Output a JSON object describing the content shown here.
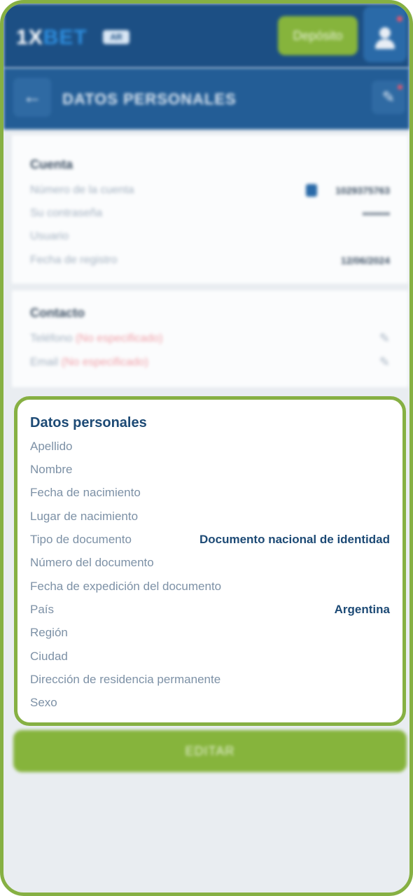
{
  "header": {
    "logo_text_1": "1X",
    "logo_text_2": "BET",
    "logo_badge": "AR",
    "deposit_label": "Depósito"
  },
  "pagebar": {
    "title": "DATOS PERSONALES"
  },
  "account": {
    "title": "Cuenta",
    "rows": [
      {
        "label": "Número de la cuenta",
        "value": "1029375763"
      },
      {
        "label": "Su contraseña",
        "value": "••••••••"
      },
      {
        "label": "Usuario",
        "value": ""
      },
      {
        "label": "Fecha de registro",
        "value": "12/06/2024"
      }
    ]
  },
  "contact": {
    "title": "Contacto",
    "phone_label": "Teléfono",
    "phone_value": "(No especificado)",
    "email_label": "Email",
    "email_value": "(No especificado)"
  },
  "personal": {
    "title": "Datos personales",
    "rows": [
      {
        "label": "Apellido",
        "value": ""
      },
      {
        "label": "Nombre",
        "value": ""
      },
      {
        "label": "Fecha de nacimiento",
        "value": ""
      },
      {
        "label": "Lugar de nacimiento",
        "value": ""
      },
      {
        "label": "Tipo de documento",
        "value": "Documento nacional de identidad"
      },
      {
        "label": "Número del documento",
        "value": ""
      },
      {
        "label": "Fecha de expedición del documento",
        "value": ""
      },
      {
        "label": "País",
        "value": "Argentina"
      },
      {
        "label": "Región",
        "value": ""
      },
      {
        "label": "Ciudad",
        "value": ""
      },
      {
        "label": "Dirección de residencia permanente",
        "value": ""
      },
      {
        "label": "Sexo",
        "value": ""
      }
    ]
  },
  "footer": {
    "edit_label": "EDITAR"
  },
  "colors": {
    "accent_green": "#86b043",
    "header_blue": "#1c4f84",
    "title_blue": "#1d4a75"
  }
}
